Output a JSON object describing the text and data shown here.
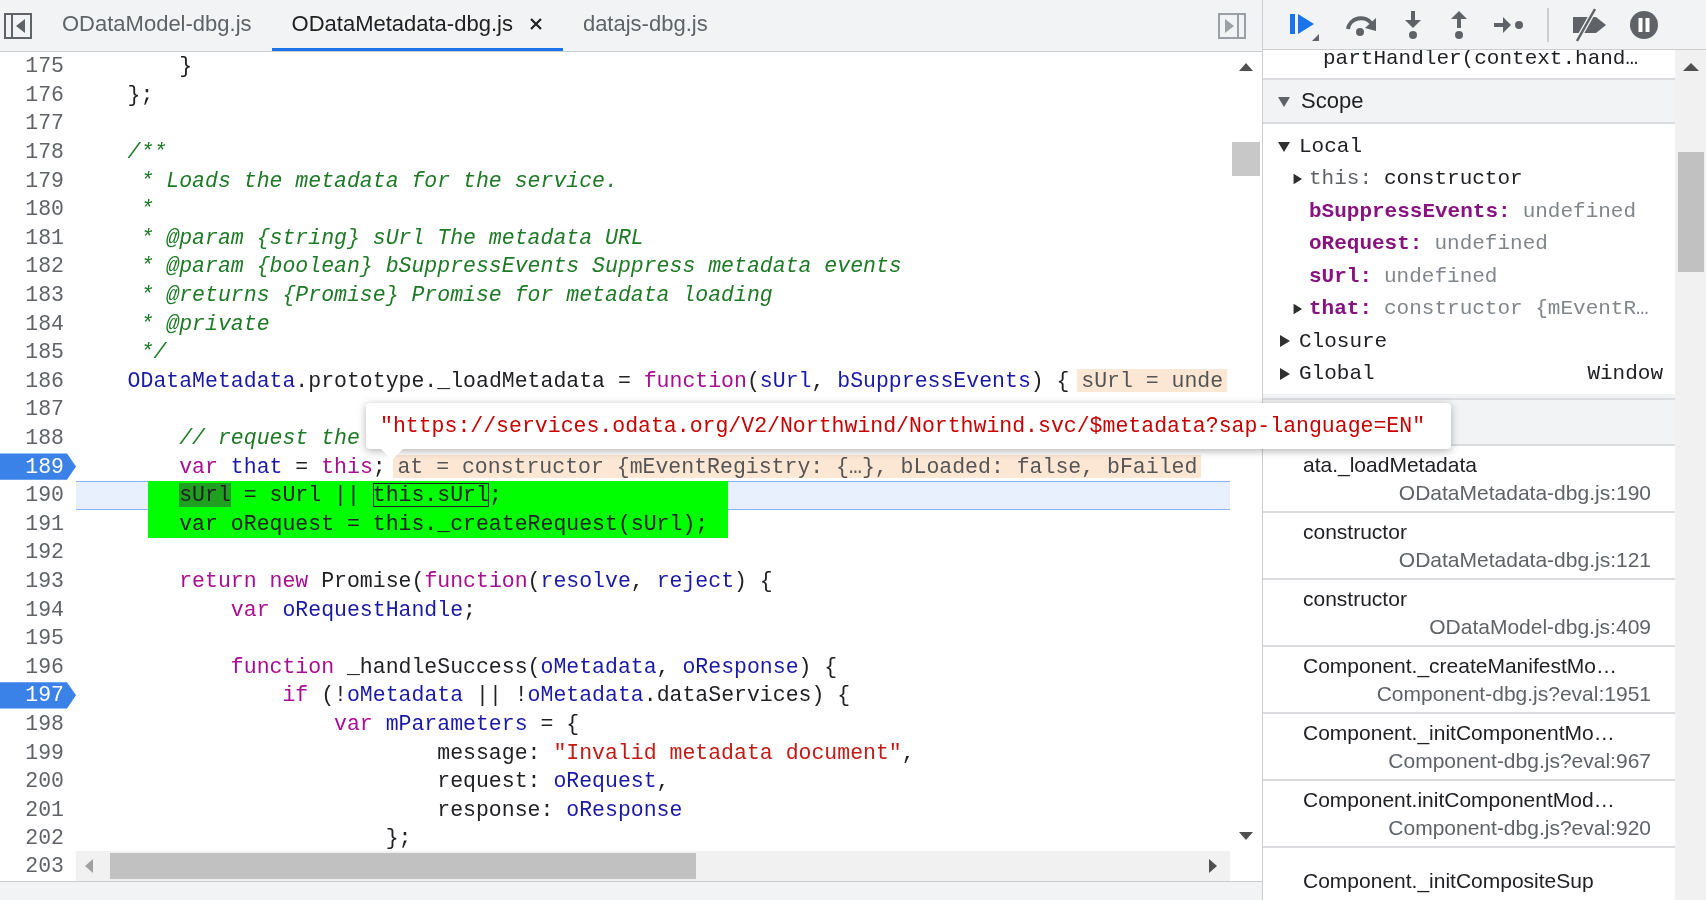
{
  "editor_tabs": [
    {
      "label": "ODataModel-dbg.js",
      "selected": false,
      "closable": false
    },
    {
      "label": "ODataMetadata-dbg.js",
      "selected": true,
      "closable": true
    },
    {
      "label": "datajs-dbg.js",
      "selected": false,
      "closable": false
    }
  ],
  "code": {
    "lines": [
      {
        "number": "175",
        "breakpoint": false,
        "current": false,
        "highlighted": false,
        "tokens": [
          {
            "text": "        }",
            "kind": "plain"
          }
        ]
      },
      {
        "number": "176",
        "breakpoint": false,
        "current": false,
        "highlighted": false,
        "tokens": [
          {
            "text": "    };",
            "kind": "plain"
          }
        ]
      },
      {
        "number": "177",
        "breakpoint": false,
        "current": false
      },
      {
        "number": "178",
        "breakpoint": false,
        "current": false,
        "highlighted": false,
        "tokens": [
          {
            "text": "    /**",
            "kind": "comment"
          }
        ]
      },
      {
        "number": "179",
        "breakpoint": false,
        "current": false,
        "highlighted": false,
        "tokens": [
          {
            "text": "     * Loads the metadata for the service.",
            "kind": "comment"
          }
        ]
      },
      {
        "number": "180",
        "breakpoint": false,
        "current": false,
        "highlighted": false,
        "tokens": [
          {
            "text": "     *",
            "kind": "comment"
          }
        ]
      },
      {
        "number": "181",
        "breakpoint": false,
        "current": false,
        "highlighted": false,
        "tokens": [
          {
            "text": "     * @param {string} sUrl The metadata URL",
            "kind": "comment"
          }
        ]
      },
      {
        "number": "182",
        "breakpoint": false,
        "current": false,
        "highlighted": false,
        "tokens": [
          {
            "text": "     * @param {boolean} bSuppressEvents Suppress metadata events",
            "kind": "comment"
          }
        ]
      },
      {
        "number": "183",
        "breakpoint": false,
        "current": false,
        "highlighted": false,
        "tokens": [
          {
            "text": "     * @returns {Promise} Promise for metadata loading",
            "kind": "comment"
          }
        ]
      },
      {
        "number": "184",
        "breakpoint": false,
        "current": false,
        "highlighted": false,
        "tokens": [
          {
            "text": "     * @private",
            "kind": "comment"
          }
        ]
      },
      {
        "number": "185",
        "breakpoint": false,
        "current": false,
        "highlighted": false,
        "tokens": [
          {
            "text": "     */",
            "kind": "comment"
          }
        ]
      },
      {
        "number": "186",
        "breakpoint": false,
        "current": false,
        "highlighted": false,
        "tokens": [
          {
            "text": "    ODataMetadata",
            "kind": "def"
          },
          {
            "text": ".prototype._loadMetadata = ",
            "kind": "plain"
          },
          {
            "text": "function",
            "kind": "keyword"
          },
          {
            "text": "(",
            "kind": "plain"
          },
          {
            "text": "sUrl",
            "kind": "def"
          },
          {
            "text": ", ",
            "kind": "plain"
          },
          {
            "text": "bSuppressEvents",
            "kind": "def"
          },
          {
            "text": ") {",
            "kind": "plain"
          }
        ],
        "inline_value": "sUrl = unde"
      },
      {
        "number": "187",
        "breakpoint": false,
        "current": false
      },
      {
        "number": "188",
        "breakpoint": false,
        "current": false,
        "highlighted": false,
        "tokens": [
          {
            "text": "        // request the",
            "kind": "comment"
          }
        ]
      },
      {
        "number": "189",
        "breakpoint": true,
        "current": false,
        "highlighted": false,
        "tokens": [
          {
            "text": "        var",
            "kind": "keyword"
          },
          {
            "text": " that",
            "kind": "def"
          },
          {
            "text": " = ",
            "kind": "plain"
          },
          {
            "text": "this",
            "kind": "keyword"
          },
          {
            "text": ";",
            "kind": "plain"
          }
        ],
        "inline_value": "at = constructor {mEventRegistry: {…}, bLoaded: false, bFailed"
      },
      {
        "number": "190",
        "breakpoint": false,
        "current": true,
        "highlighted": true,
        "tokens": [
          {
            "text": "        sUrl",
            "kind": "match"
          },
          {
            "text": " = sUrl || ",
            "kind": "plain"
          },
          {
            "text": "this.sUrl",
            "kind": "boxed"
          },
          {
            "text": ";",
            "kind": "plain"
          }
        ]
      },
      {
        "number": "191",
        "breakpoint": false,
        "current": false,
        "highlighted": true,
        "tokens": [
          {
            "text": "        var oRequest = this._createRequest(sUrl);",
            "kind": "plain"
          }
        ]
      },
      {
        "number": "192",
        "breakpoint": false,
        "current": false
      },
      {
        "number": "193",
        "breakpoint": false,
        "current": false,
        "highlighted": false,
        "tokens": [
          {
            "text": "        return",
            "kind": "keyword"
          },
          {
            "text": " new",
            "kind": "keyword"
          },
          {
            "text": " Promise(",
            "kind": "plain"
          },
          {
            "text": "function",
            "kind": "keyword"
          },
          {
            "text": "(",
            "kind": "plain"
          },
          {
            "text": "resolve",
            "kind": "def"
          },
          {
            "text": ", ",
            "kind": "plain"
          },
          {
            "text": "reject",
            "kind": "def"
          },
          {
            "text": ") {",
            "kind": "plain"
          }
        ]
      },
      {
        "number": "194",
        "breakpoint": false,
        "current": false,
        "highlighted": false,
        "tokens": [
          {
            "text": "            var",
            "kind": "keyword"
          },
          {
            "text": " oRequestHandle",
            "kind": "def"
          },
          {
            "text": ";",
            "kind": "plain"
          }
        ]
      },
      {
        "number": "195",
        "breakpoint": false,
        "current": false
      },
      {
        "number": "196",
        "breakpoint": false,
        "current": false,
        "highlighted": false,
        "tokens": [
          {
            "text": "            function",
            "kind": "keyword"
          },
          {
            "text": " _handleSuccess(",
            "kind": "plain"
          },
          {
            "text": "oMetadata",
            "kind": "def"
          },
          {
            "text": ", ",
            "kind": "plain"
          },
          {
            "text": "oResponse",
            "kind": "def"
          },
          {
            "text": ") {",
            "kind": "plain"
          }
        ]
      },
      {
        "number": "197",
        "breakpoint": true,
        "current": false,
        "highlighted": false,
        "tokens": [
          {
            "text": "                if",
            "kind": "keyword"
          },
          {
            "text": " (!",
            "kind": "plain"
          },
          {
            "text": "oMetadata",
            "kind": "def"
          },
          {
            "text": " || !",
            "kind": "plain"
          },
          {
            "text": "oMetadata",
            "kind": "def"
          },
          {
            "text": ".dataServices) {",
            "kind": "plain"
          }
        ]
      },
      {
        "number": "198",
        "breakpoint": false,
        "current": false,
        "highlighted": false,
        "tokens": [
          {
            "text": "                    var",
            "kind": "keyword"
          },
          {
            "text": " mParameters",
            "kind": "def"
          },
          {
            "text": " = {",
            "kind": "plain"
          }
        ]
      },
      {
        "number": "199",
        "breakpoint": false,
        "current": false,
        "highlighted": false,
        "tokens": [
          {
            "text": "                            message: ",
            "kind": "plain"
          },
          {
            "text": "\"Invalid metadata document\"",
            "kind": "string"
          },
          {
            "text": ",",
            "kind": "plain"
          }
        ]
      },
      {
        "number": "200",
        "breakpoint": false,
        "current": false,
        "highlighted": false,
        "tokens": [
          {
            "text": "                            request: ",
            "kind": "plain"
          },
          {
            "text": "oRequest",
            "kind": "def"
          },
          {
            "text": ",",
            "kind": "plain"
          }
        ]
      },
      {
        "number": "201",
        "breakpoint": false,
        "current": false,
        "highlighted": false,
        "tokens": [
          {
            "text": "                            response: ",
            "kind": "plain"
          },
          {
            "text": "oResponse",
            "kind": "def"
          }
        ]
      },
      {
        "number": "202",
        "breakpoint": false,
        "current": false,
        "highlighted": false,
        "tokens": [
          {
            "text": "                        };",
            "kind": "plain"
          }
        ]
      }
    ],
    "last_line_number": "203"
  },
  "tooltip": {
    "text": "\"https://services.odata.org/V2/Northwind/Northwind.svc/$metadata?sap-language=EN\""
  },
  "debugger": {
    "call_frame_partial": "partHandler(context.hand…",
    "scope": {
      "title": "Scope",
      "expanded": true,
      "groups": [
        {
          "name": "Local",
          "expanded": true,
          "children": [
            {
              "name": "this:",
              "value": "constructor",
              "kind": "receiver",
              "expandable": true
            },
            {
              "name": "bSuppressEvents:",
              "value": "undefined",
              "kind": "variable",
              "expandable": false
            },
            {
              "name": "oRequest:",
              "value": "undefined",
              "kind": "variable",
              "expandable": false
            },
            {
              "name": "sUrl:",
              "value": "undefined",
              "kind": "variable",
              "expandable": false
            },
            {
              "name": "that:",
              "value": "constructor {mEventR…",
              "kind": "variable",
              "expandable": true
            }
          ]
        },
        {
          "name": "Closure",
          "expanded": false
        },
        {
          "name": "Global",
          "expanded": false,
          "value": "Window"
        }
      ]
    },
    "call_stack": {
      "frames": [
        {
          "function": "ata._loadMetadata",
          "location": "ODataMetadata-dbg.js:190"
        },
        {
          "function": "constructor",
          "location": "ODataMetadata-dbg.js:121"
        },
        {
          "function": "constructor",
          "location": "ODataModel-dbg.js:409"
        },
        {
          "function": "Component._createManifestMo…",
          "location": "Component-dbg.js?eval:1951"
        },
        {
          "function": "Component._initComponentMo…",
          "location": "Component-dbg.js?eval:967"
        },
        {
          "function": "Component.initComponentMod…",
          "location": "Component-dbg.js?eval:920"
        },
        {
          "function": "Component._initCompositeSup"
        }
      ]
    }
  }
}
